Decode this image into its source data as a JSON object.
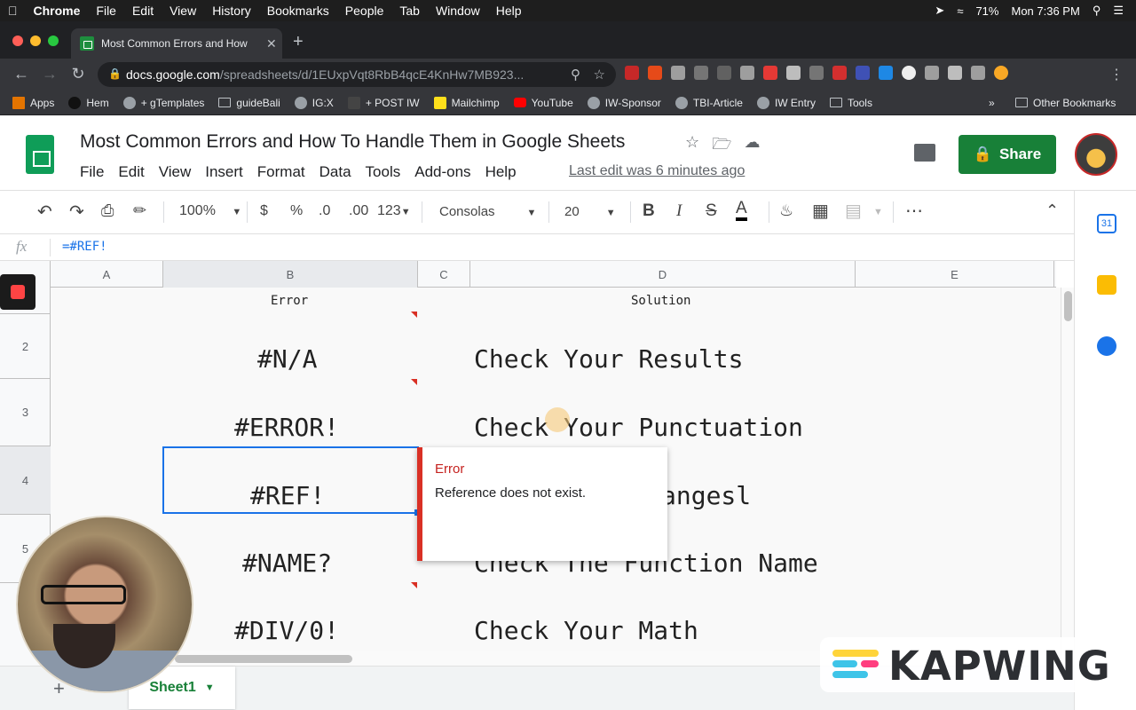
{
  "menubar": {
    "app": "Chrome",
    "items": [
      "File",
      "Edit",
      "View",
      "History",
      "Bookmarks",
      "People",
      "Tab",
      "Window",
      "Help"
    ],
    "battery": "71%",
    "clock": "Mon 7:36 PM"
  },
  "browser": {
    "tab_title": "Most Common Errors and How",
    "url_host": "docs.google.com",
    "url_path": "/spreadsheets/d/1EUxpVqt8RbB4qcE4KnHw7MB923...",
    "bookmarks": [
      "Apps",
      "Hem",
      "+ gTemplates",
      "guideBali",
      "IG:X",
      "+ POST IW",
      "Mailchimp",
      "YouTube",
      "IW-Sponsor",
      "TBI-Article",
      "IW Entry",
      "Tools"
    ],
    "bookmarks_more": "»",
    "other_bookmarks": "Other Bookmarks"
  },
  "doc": {
    "title": "Most Common Errors and How To Handle Them in Google Sheets",
    "menu": [
      "File",
      "Edit",
      "View",
      "Insert",
      "Format",
      "Data",
      "Tools",
      "Add-ons",
      "Help"
    ],
    "last_edit": "Last edit was 6 minutes ago",
    "share_label": "Share"
  },
  "toolbar": {
    "zoom": "100%",
    "currency": "$",
    "percent": "%",
    "dec_less": ".0",
    "dec_more": ".00",
    "format_more": "123",
    "font": "Consolas",
    "font_size": "20",
    "bold": "B",
    "italic": "I",
    "strike": "S",
    "text_color": "A"
  },
  "formula": {
    "fx": "fx",
    "value": "=#REF!"
  },
  "grid": {
    "columns": [
      "A",
      "B",
      "C",
      "D",
      "E"
    ],
    "rows": [
      "2",
      "3",
      "4",
      "5"
    ],
    "header": {
      "error": "Error",
      "solution": "Solution"
    },
    "entries": [
      {
        "error": "#N/A",
        "solution": "Check Your Results"
      },
      {
        "error": "#ERROR!",
        "solution": "Check Your Punctuation"
      },
      {
        "error": "#REF!",
        "solution": "angesl"
      },
      {
        "error": "#NAME?",
        "solution": "Check The Function Name"
      },
      {
        "error": "#DIV/0!",
        "solution": "Check Your Math"
      }
    ]
  },
  "error_popup": {
    "title": "Error",
    "message": "Reference does not exist."
  },
  "sheets": {
    "add": "+",
    "active": "Sheet1"
  },
  "side_panel": {
    "calendar_day": "31"
  },
  "watermark": "KAPWING",
  "colors": {
    "share_green": "#188038",
    "error_red": "#d93025",
    "selection_blue": "#1a73e8"
  }
}
